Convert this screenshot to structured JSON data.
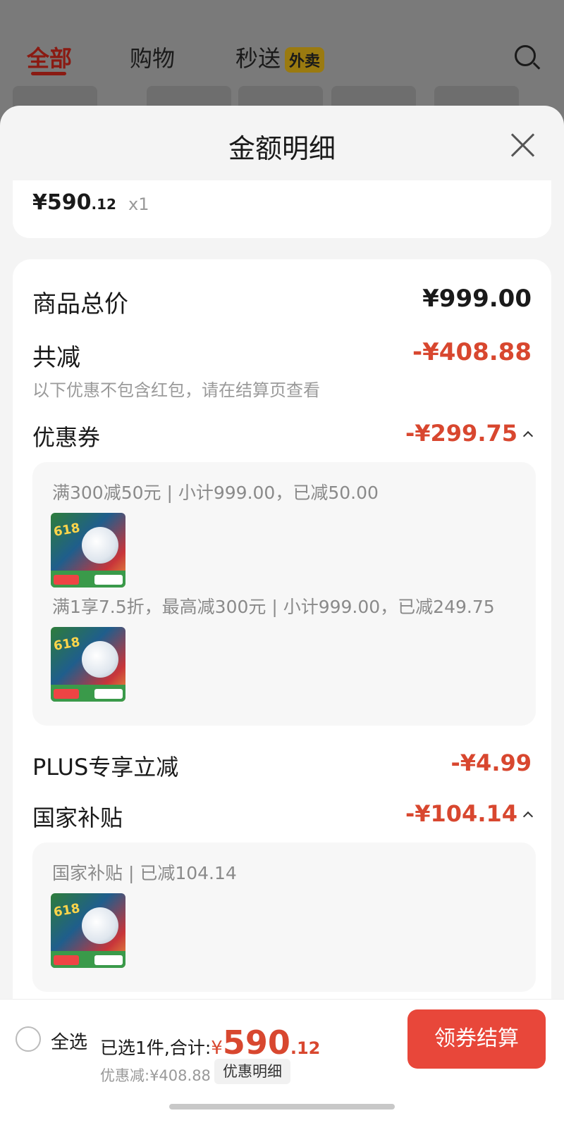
{
  "background": {
    "tabs": [
      "全部",
      "购物",
      "秒送"
    ],
    "takeout_badge": "外卖"
  },
  "sheet": {
    "title": "金额明细",
    "item": {
      "price_int": "¥590",
      "price_dec": ".12",
      "qty": "x1"
    },
    "total_price": {
      "label": "商品总价",
      "value": "¥999.00"
    },
    "total_reduction": {
      "label": "共减",
      "value": "-¥408.88",
      "note": "以下优惠不包含红包，请在结算页查看"
    },
    "coupons": {
      "label": "优惠券",
      "value": "-¥299.75",
      "entries": [
        {
          "text": "满300减50元 | 小计999.00，已减50.00"
        },
        {
          "text": "满1享7.5折，最高减300元 | 小计999.00，已减249.75"
        }
      ]
    },
    "plus": {
      "label": "PLUS专享立减",
      "value": "-¥4.99"
    },
    "subsidy": {
      "label": "国家补贴",
      "value": "-¥104.14",
      "entries": [
        {
          "text": "国家补贴 | 已减104.14"
        }
      ]
    },
    "thumb_badge": "618"
  },
  "bottom": {
    "select_all": "全选",
    "selected_prefix": "已选1件,合计:",
    "total_currency": "¥",
    "total_int": "590",
    "total_dec": ".12",
    "discount": "优惠减:¥408.88",
    "detail_button": "优惠明细",
    "checkout_button": "领券结算"
  }
}
